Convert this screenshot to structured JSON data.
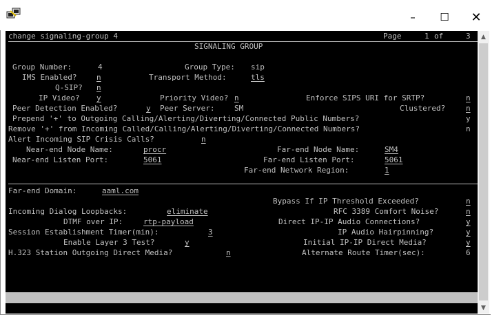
{
  "window": {
    "icon": "putty-terminal-icon",
    "minimize_glyph": "–",
    "maximize_glyph": "☐",
    "close_glyph": "✕"
  },
  "terminal": {
    "command": "change signaling-group 4",
    "page_label": "Page",
    "page_current": "1",
    "page_of": "of",
    "page_total": "3",
    "form_title": "SIGNALING GROUP",
    "group_number_label": "Group Number:",
    "group_number": "4",
    "group_type_label": "Group Type:",
    "group_type": "sip",
    "ims_enabled_label": "IMS Enabled?",
    "ims_enabled": "n",
    "transport_method_label": "Transport Method:",
    "transport_method": "tls",
    "qsip_label": "Q-SIP?",
    "qsip": "n",
    "ip_video_label": "IP Video?",
    "ip_video": "y",
    "priority_video_label": "Priority Video?",
    "priority_video": "n",
    "enforce_sips_label": "Enforce SIPS URI for SRTP?",
    "enforce_sips": "n",
    "peer_detection_label": "Peer Detection Enabled?",
    "peer_detection": "y",
    "peer_server_label": "Peer Server:",
    "peer_server": "SM",
    "clustered_label": "Clustered?",
    "clustered": "n",
    "prepend_label": "Prepend '+' to Outgoing Calling/Alerting/Diverting/Connected Public Numbers?",
    "prepend": "y",
    "remove_label": "Remove '+' from Incoming Called/Calling/Alerting/Diverting/Connected Numbers?",
    "remove": "n",
    "alert_crisis_label": "Alert Incoming SIP Crisis Calls?",
    "alert_crisis": "n",
    "near_node_label": "Near-end Node Name:",
    "near_node": "procr",
    "far_node_label": "Far-end Node Name:",
    "far_node": "SM4",
    "near_port_label": "Near-end Listen Port:",
    "near_port": "5061",
    "far_port_label": "Far-end Listen Port:",
    "far_port": "5061",
    "far_region_label": "Far-end Network Region:",
    "far_region": "1",
    "far_domain_label": "Far-end Domain:",
    "far_domain": "aaml.com",
    "bypass_label": "Bypass If IP Threshold Exceeded?",
    "bypass": "n",
    "loopbacks_label": "Incoming Dialog Loopbacks:",
    "loopbacks": "eliminate",
    "rfc3389_label": "RFC 3389 Comfort Noise?",
    "rfc3389": "n",
    "dtmf_label": "DTMF over IP:",
    "dtmf": "rtp-payload",
    "direct_audio_label": "Direct IP-IP Audio Connections?",
    "direct_audio": "y",
    "session_timer_label": "Session Establishment Timer(min):",
    "session_timer": "3",
    "hairpin_label": "IP Audio Hairpinning?",
    "hairpin": "y",
    "layer3_label": "Enable Layer 3 Test?",
    "layer3": "y",
    "initial_direct_label": "Initial IP-IP Direct Media?",
    "initial_direct": "y",
    "h323_label": "H.323 Station Outgoing Direct Media?",
    "h323": "n",
    "alt_route_label": "Alternate Route Timer(sec):",
    "alt_route": "6"
  }
}
